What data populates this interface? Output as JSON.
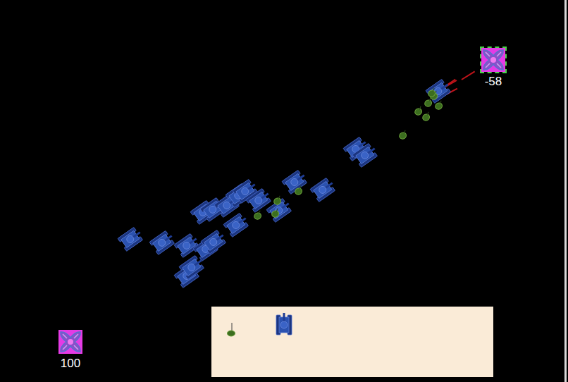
{
  "bases": [
    {
      "label": "-58",
      "selected": true
    },
    {
      "label": "100",
      "selected": false
    }
  ],
  "units": [
    {
      "kind": "tank"
    },
    {
      "kind": "tank"
    },
    {
      "kind": "tank"
    },
    {
      "kind": "tank"
    },
    {
      "kind": "tank"
    },
    {
      "kind": "tank"
    },
    {
      "kind": "tank"
    },
    {
      "kind": "tank"
    },
    {
      "kind": "tank"
    },
    {
      "kind": "tank"
    },
    {
      "kind": "tank"
    },
    {
      "kind": "tank"
    },
    {
      "kind": "tank"
    },
    {
      "kind": "tank"
    },
    {
      "kind": "tank"
    },
    {
      "kind": "tank"
    },
    {
      "kind": "tank"
    },
    {
      "kind": "tank"
    },
    {
      "kind": "tank"
    },
    {
      "kind": "tank"
    },
    {
      "kind": "soldier"
    },
    {
      "kind": "soldier"
    },
    {
      "kind": "soldier"
    },
    {
      "kind": "soldier"
    },
    {
      "kind": "soldier"
    },
    {
      "kind": "soldier"
    },
    {
      "kind": "soldier"
    },
    {
      "kind": "soldier"
    },
    {
      "kind": "soldier"
    },
    {
      "kind": "soldier"
    },
    {
      "kind": "soldier"
    }
  ],
  "palette": [
    {
      "kind": "soldier"
    },
    {
      "kind": "tank"
    }
  ]
}
